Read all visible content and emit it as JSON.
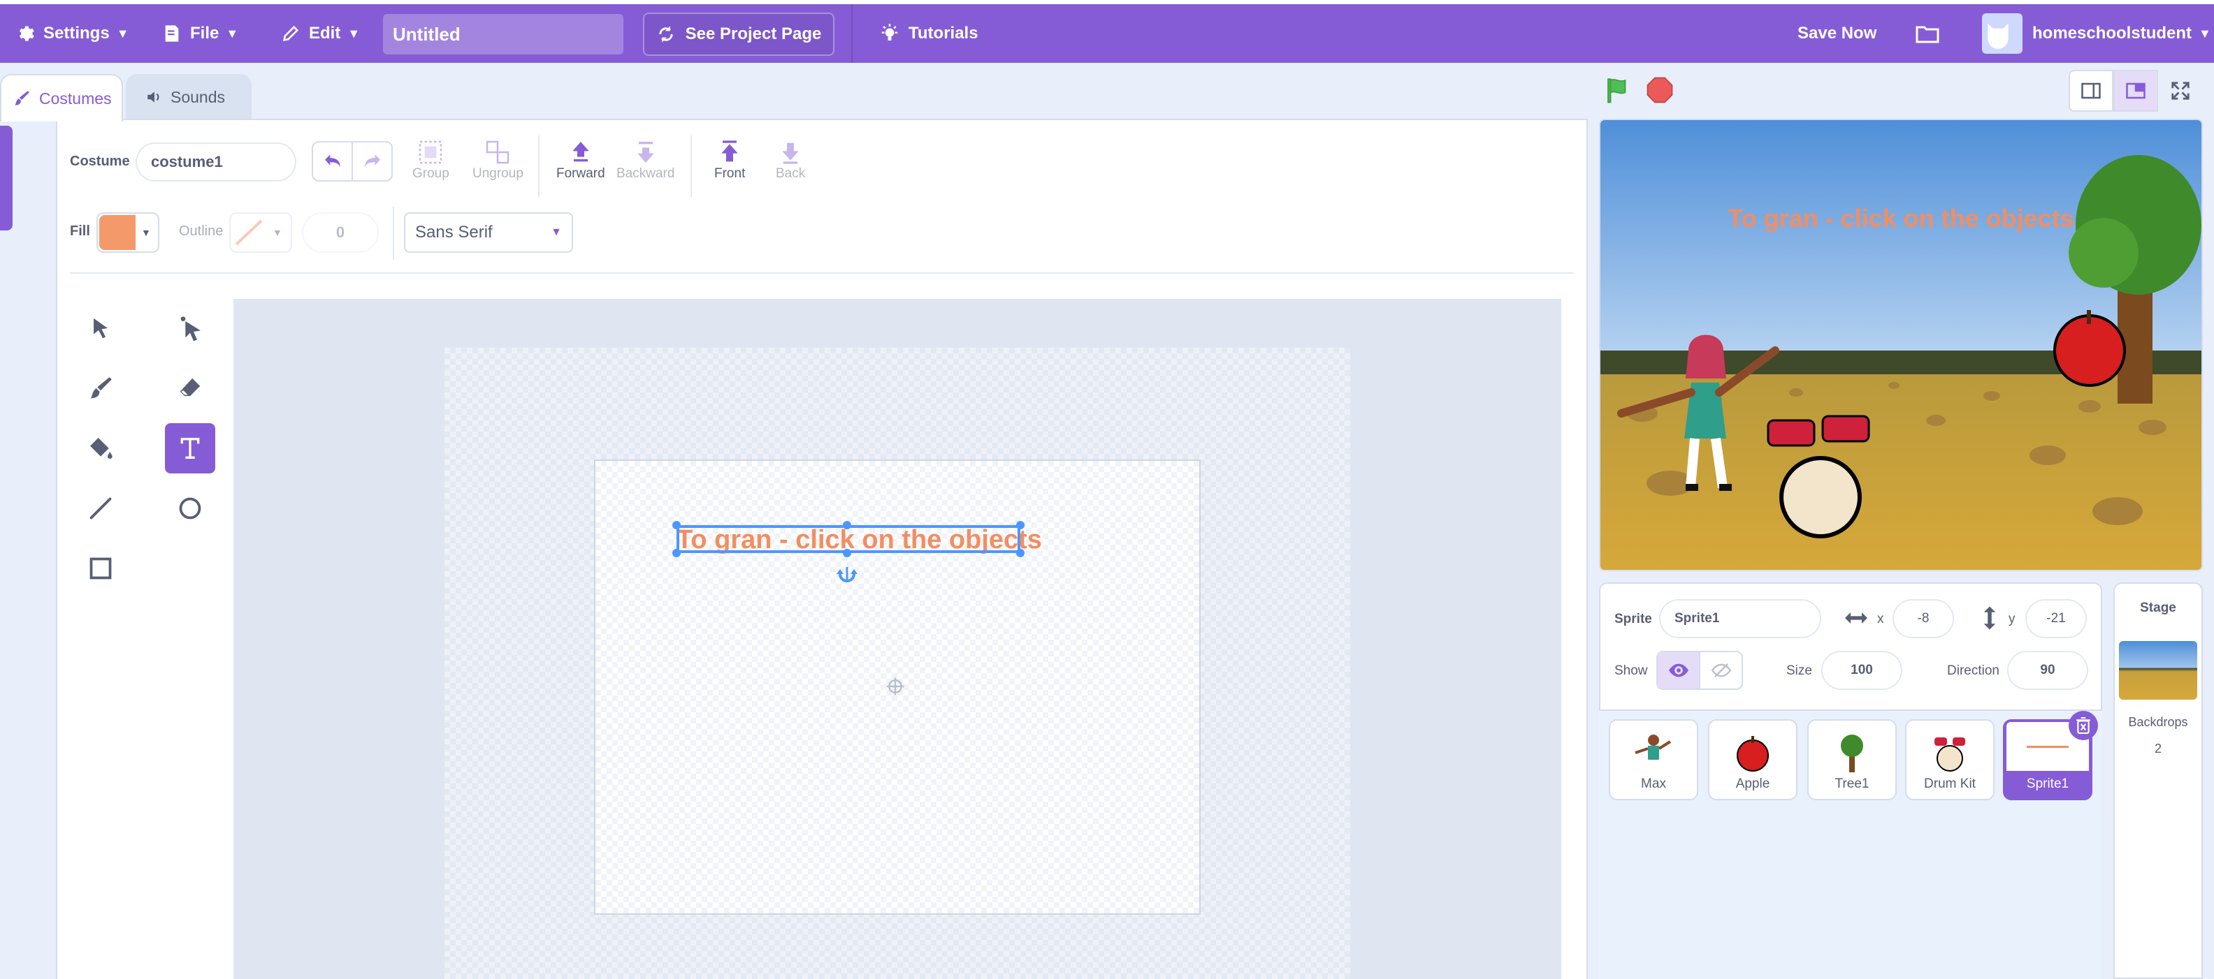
{
  "menubar": {
    "settings": "Settings",
    "file": "File",
    "edit": "Edit",
    "project_title": "Untitled",
    "see_project": "See Project Page",
    "tutorials": "Tutorials",
    "save_now": "Save Now",
    "username": "homeschoolstudent"
  },
  "tabs": {
    "costumes": "Costumes",
    "sounds": "Sounds"
  },
  "paint": {
    "costume_label": "Costume",
    "costume_name": "costume1",
    "group": "Group",
    "ungroup": "Ungroup",
    "forward": "Forward",
    "backward": "Backward",
    "front": "Front",
    "back": "Back",
    "fill_label": "Fill",
    "fill_color": "#f4996a",
    "outline_label": "Outline",
    "outline_width": "0",
    "font": "Sans Serif",
    "selected_tool": "text-tool",
    "canvas_text": "To gran - click on the objects"
  },
  "stage": {
    "title_text": "To gran - click on the objects"
  },
  "sprite_info": {
    "sprite_label": "Sprite",
    "sprite_name": "Sprite1",
    "x_label": "x",
    "x_value": "-8",
    "y_label": "y",
    "y_value": "-21",
    "show_label": "Show",
    "size_label": "Size",
    "size_value": "100",
    "direction_label": "Direction",
    "direction_value": "90"
  },
  "sprites": [
    {
      "name": "Max"
    },
    {
      "name": "Apple"
    },
    {
      "name": "Tree1"
    },
    {
      "name": "Drum Kit"
    },
    {
      "name": "Sprite1",
      "selected": true
    }
  ],
  "stage_panel": {
    "title": "Stage",
    "backdrops_label": "Backdrops",
    "backdrops_count": "2"
  },
  "colors": {
    "accent": "#855cd6",
    "text_orange": "#f28e63"
  }
}
